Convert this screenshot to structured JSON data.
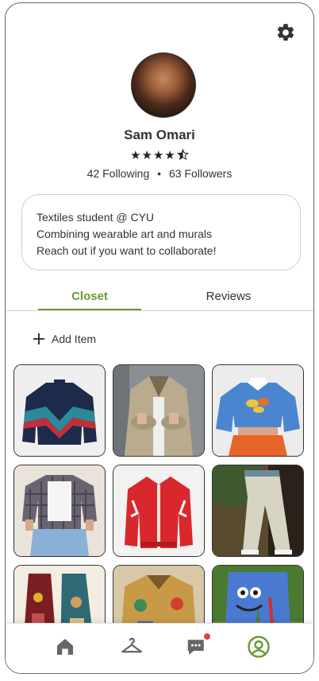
{
  "profile": {
    "name": "Sam Omari",
    "rating": 4.5,
    "rating_stars": "★★★★",
    "following": "42 Following",
    "followers": "63 Followers",
    "separator": "•"
  },
  "bio": {
    "lines": [
      "Textiles student @ CYU",
      "Combining wearable art and murals",
      "Reach out if you want to collaborate!"
    ]
  },
  "tabs": {
    "closet": "Closet",
    "reviews": "Reviews"
  },
  "closet": {
    "add_item_label": "Add Item",
    "items": [
      {
        "kind": "windbreaker-jacket"
      },
      {
        "kind": "canvas-work-jacket"
      },
      {
        "kind": "blue-cropped-sweatshirt"
      },
      {
        "kind": "plaid-shirt-and-jeans"
      },
      {
        "kind": "red-varsity-jacket"
      },
      {
        "kind": "khaki-pants"
      },
      {
        "kind": "painted-jackets"
      },
      {
        "kind": "painted-denim-jacket"
      },
      {
        "kind": "painted-blue-jeans"
      }
    ]
  },
  "colors": {
    "accent": "#6b9a3a",
    "notification": "#e0404a",
    "icon": "#666666"
  },
  "nav": {
    "active": "profile"
  }
}
